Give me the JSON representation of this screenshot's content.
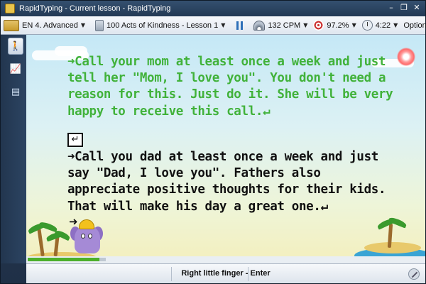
{
  "window": {
    "title": "RapidTyping - Current lesson - RapidTyping"
  },
  "toolbar": {
    "course": "EN 4. Advanced",
    "lesson": "100 Acts of Kindness - Lesson 1",
    "speed": "132 CPM",
    "accuracy": "97.2%",
    "time": "4:22",
    "options_label": "Options"
  },
  "lesson_text": {
    "typed": "➜Call your mom at least once a week and just tell her \"Mom, I love you\". You don't need a reason for this. Just do it. She will be very happy to receive this call.↵",
    "enter_key": "↵",
    "pending": "➜Call you dad at least once a week and just say \"Dad, I love you\". Fathers also appreciate positive thoughts for their kids. That will make his day a great one.↵",
    "next_marker": "➜"
  },
  "status": {
    "finger_hint": "Right little finger - Enter"
  },
  "progress": {
    "fraction": 0.92
  },
  "colors": {
    "typed": "#41b23a",
    "pending": "#111111",
    "progress": "#4caf2b"
  },
  "icons": {
    "sidebar": [
      "walking-person-icon",
      "chart-icon",
      "documents-icon"
    ],
    "toolbar": [
      "folder-icon",
      "document-icon",
      "pause-icon",
      "speedometer-icon",
      "target-icon",
      "clock-icon"
    ]
  }
}
